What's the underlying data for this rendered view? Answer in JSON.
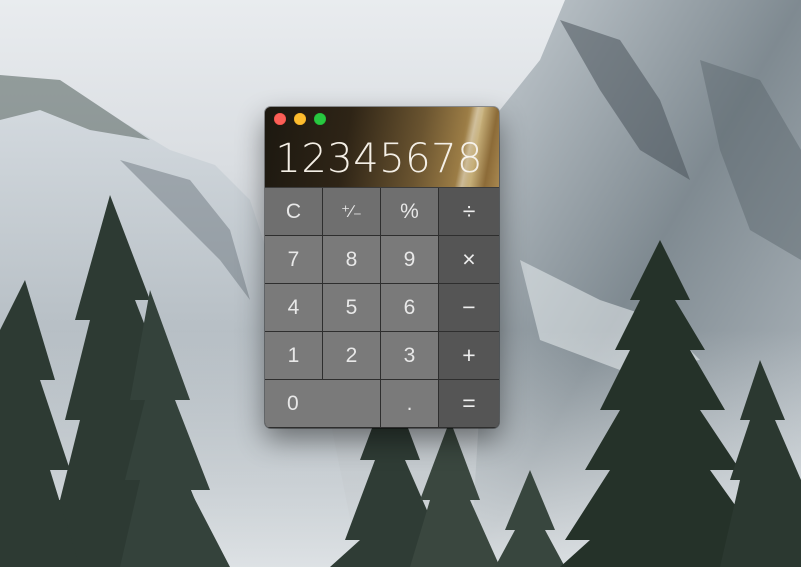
{
  "calculator": {
    "display_value": "12345678",
    "keys": [
      {
        "id": "clear",
        "label": "C",
        "kind": "fn"
      },
      {
        "id": "plus-minus",
        "label": "⁺∕₋",
        "kind": "fn"
      },
      {
        "id": "percent",
        "label": "%",
        "kind": "fn"
      },
      {
        "id": "divide",
        "label": "÷",
        "kind": "op"
      },
      {
        "id": "7",
        "label": "7",
        "kind": "num"
      },
      {
        "id": "8",
        "label": "8",
        "kind": "num"
      },
      {
        "id": "9",
        "label": "9",
        "kind": "num"
      },
      {
        "id": "multiply",
        "label": "×",
        "kind": "op"
      },
      {
        "id": "4",
        "label": "4",
        "kind": "num"
      },
      {
        "id": "5",
        "label": "5",
        "kind": "num"
      },
      {
        "id": "6",
        "label": "6",
        "kind": "num"
      },
      {
        "id": "subtract",
        "label": "−",
        "kind": "op"
      },
      {
        "id": "1",
        "label": "1",
        "kind": "num"
      },
      {
        "id": "2",
        "label": "2",
        "kind": "num"
      },
      {
        "id": "3",
        "label": "3",
        "kind": "num"
      },
      {
        "id": "add",
        "label": "+",
        "kind": "op"
      },
      {
        "id": "0",
        "label": "0",
        "kind": "num"
      },
      {
        "id": "decimal",
        "label": ".",
        "kind": "num"
      },
      {
        "id": "equals",
        "label": "=",
        "kind": "op"
      }
    ]
  },
  "window_controls": {
    "close_color": "#fc5f57",
    "minimize_color": "#fdbc2e",
    "zoom_color": "#28c840"
  }
}
